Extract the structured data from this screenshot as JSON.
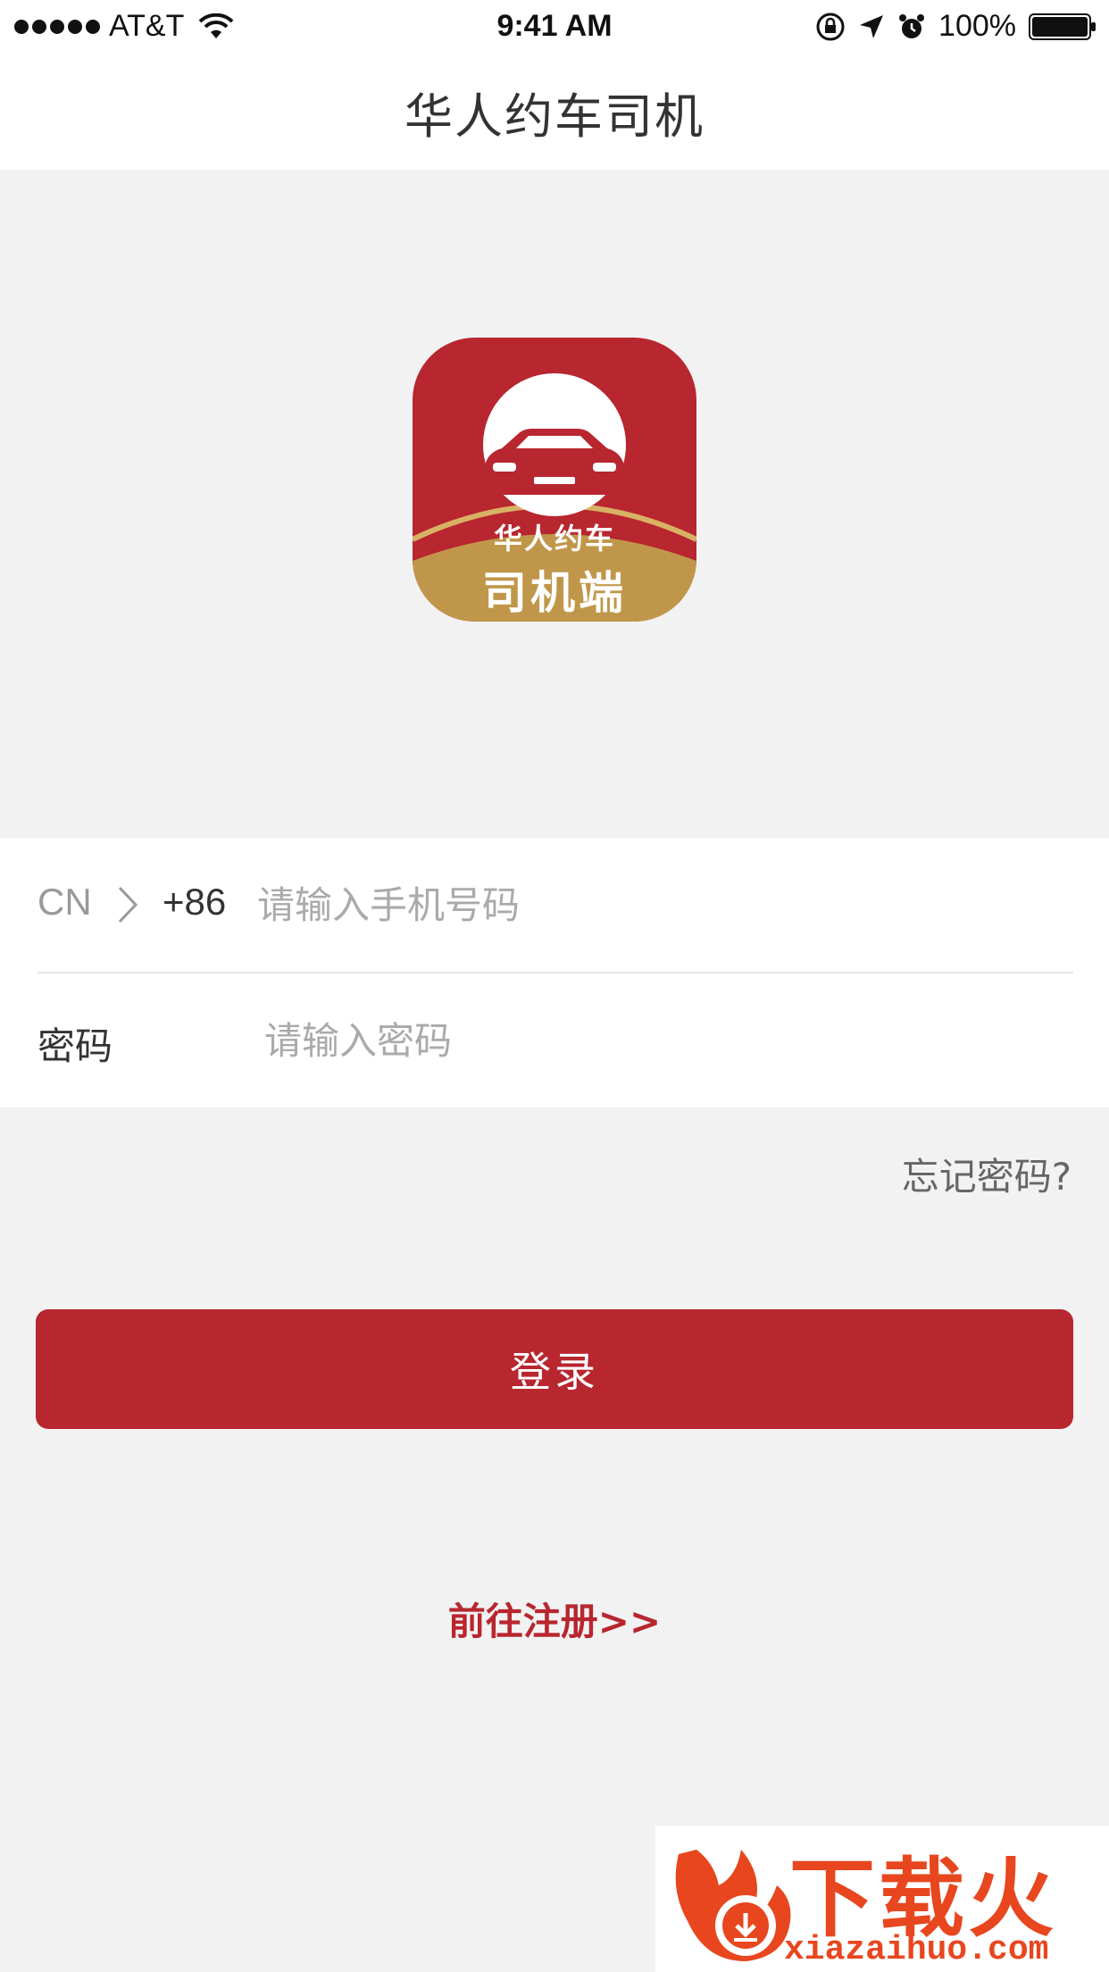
{
  "status_bar": {
    "carrier": "AT&T",
    "time": "9:41 AM",
    "battery": "100%"
  },
  "nav": {
    "title": "华人约车司机"
  },
  "logo": {
    "line1": "华人约车",
    "line2": "司机端"
  },
  "form": {
    "region": "CN",
    "country_code": "+86",
    "phone_placeholder": "请输入手机号码",
    "password_label": "密码",
    "password_placeholder": "请输入密码"
  },
  "forgot_password": "忘记密码?",
  "login_button": "登录",
  "register_link": "前往注册>>",
  "watermark": {
    "cn": "下载火",
    "en": "xiazaihuo.com"
  },
  "colors": {
    "brand_red": "#b8262f",
    "gold": "#c0974a",
    "background": "#f2f2f2"
  }
}
